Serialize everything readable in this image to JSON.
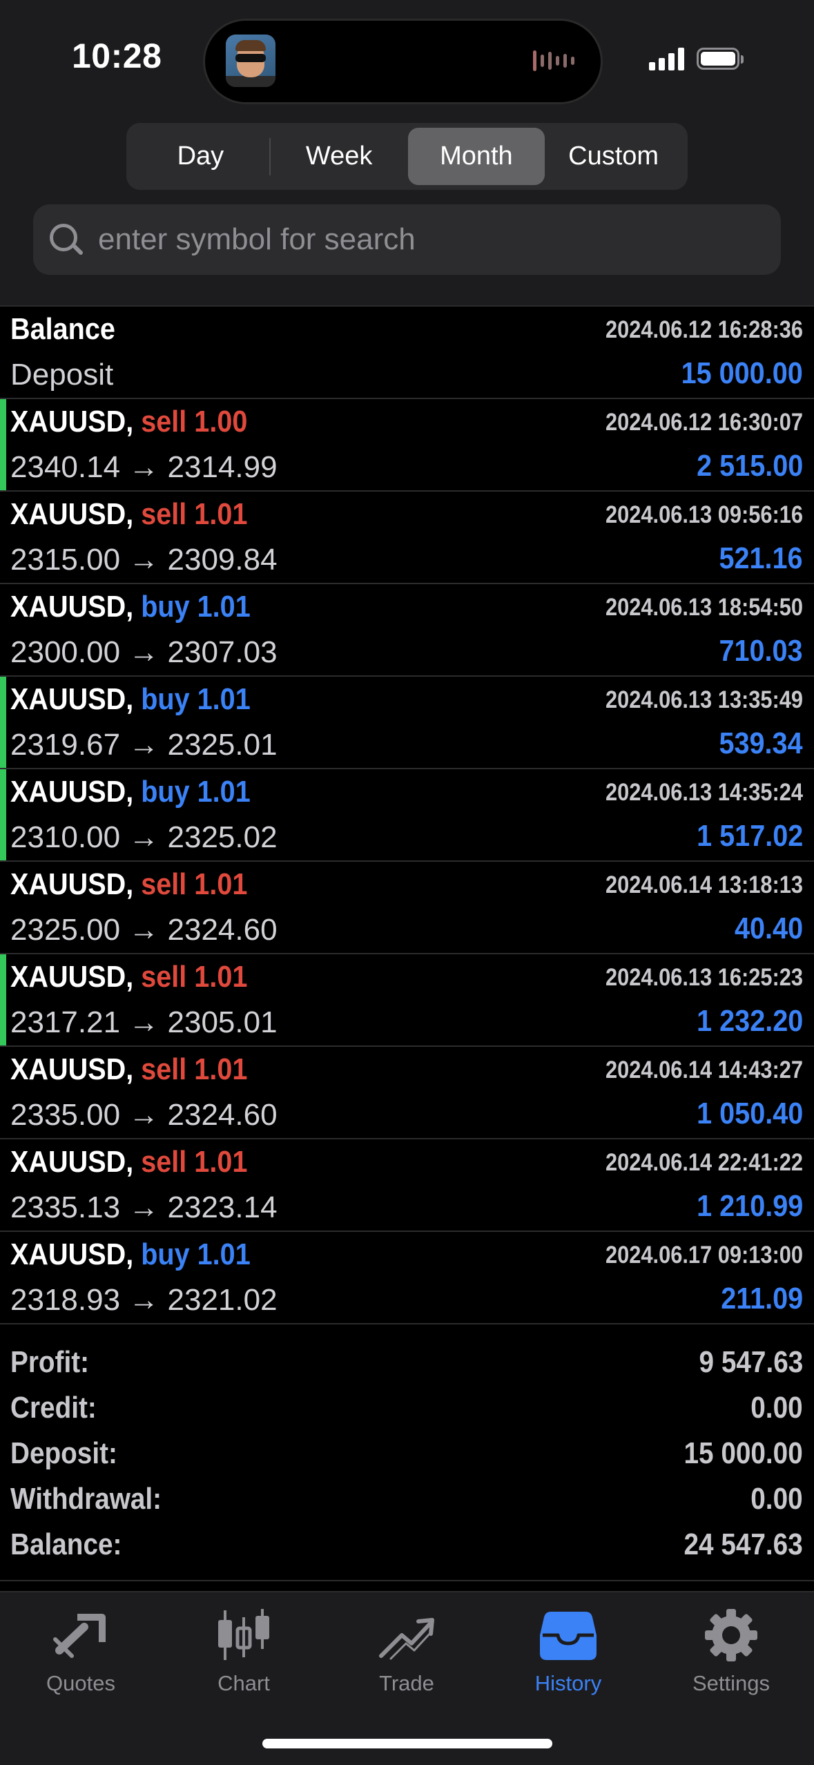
{
  "status_bar": {
    "time": "10:28"
  },
  "segmented": {
    "options": [
      "Day",
      "Week",
      "Month",
      "Custom"
    ],
    "selected": "Month"
  },
  "search": {
    "placeholder": "enter symbol for search"
  },
  "balance_row": {
    "title": "Balance",
    "timestamp": "2024.06.12 16:28:36",
    "subtitle": "Deposit",
    "amount": "15 000.00"
  },
  "trades": [
    {
      "symbol": "XAUUSD,",
      "side": "sell 1.00",
      "type": "sell",
      "timestamp": "2024.06.12 16:30:07",
      "prices": "2340.14 → 2314.99",
      "profit": "2 515.00",
      "marked": true
    },
    {
      "symbol": "XAUUSD,",
      "side": "sell 1.01",
      "type": "sell",
      "timestamp": "2024.06.13 09:56:16",
      "prices": "2315.00 → 2309.84",
      "profit": "521.16",
      "marked": false
    },
    {
      "symbol": "XAUUSD,",
      "side": "buy 1.01",
      "type": "buy",
      "timestamp": "2024.06.13 18:54:50",
      "prices": "2300.00 → 2307.03",
      "profit": "710.03",
      "marked": false
    },
    {
      "symbol": "XAUUSD,",
      "side": "buy 1.01",
      "type": "buy",
      "timestamp": "2024.06.13 13:35:49",
      "prices": "2319.67 → 2325.01",
      "profit": "539.34",
      "marked": true
    },
    {
      "symbol": "XAUUSD,",
      "side": "buy 1.01",
      "type": "buy",
      "timestamp": "2024.06.13 14:35:24",
      "prices": "2310.00 → 2325.02",
      "profit": "1 517.02",
      "marked": true
    },
    {
      "symbol": "XAUUSD,",
      "side": "sell 1.01",
      "type": "sell",
      "timestamp": "2024.06.14 13:18:13",
      "prices": "2325.00 → 2324.60",
      "profit": "40.40",
      "marked": false
    },
    {
      "symbol": "XAUUSD,",
      "side": "sell 1.01",
      "type": "sell",
      "timestamp": "2024.06.13 16:25:23",
      "prices": "2317.21 → 2305.01",
      "profit": "1 232.20",
      "marked": true
    },
    {
      "symbol": "XAUUSD,",
      "side": "sell 1.01",
      "type": "sell",
      "timestamp": "2024.06.14 14:43:27",
      "prices": "2335.00 → 2324.60",
      "profit": "1 050.40",
      "marked": false
    },
    {
      "symbol": "XAUUSD,",
      "side": "sell 1.01",
      "type": "sell",
      "timestamp": "2024.06.14 22:41:22",
      "prices": "2335.13 → 2323.14",
      "profit": "1 210.99",
      "marked": false
    },
    {
      "symbol": "XAUUSD,",
      "side": "buy 1.01",
      "type": "buy",
      "timestamp": "2024.06.17 09:13:00",
      "prices": "2318.93 → 2321.02",
      "profit": "211.09",
      "marked": false
    }
  ],
  "summary": [
    {
      "label": "Profit:",
      "value": "9 547.63"
    },
    {
      "label": "Credit:",
      "value": "0.00"
    },
    {
      "label": "Deposit:",
      "value": "15 000.00"
    },
    {
      "label": "Withdrawal:",
      "value": "0.00"
    },
    {
      "label": "Balance:",
      "value": "24 547.63"
    }
  ],
  "tabbar": {
    "items": [
      {
        "label": "Quotes",
        "icon": "quotes-icon"
      },
      {
        "label": "Chart",
        "icon": "candlestick-chart-icon"
      },
      {
        "label": "Trade",
        "icon": "trade-trend-icon"
      },
      {
        "label": "History",
        "icon": "history-tray-icon"
      },
      {
        "label": "Settings",
        "icon": "gear-icon"
      }
    ],
    "active": "History"
  },
  "colors": {
    "sell": "#e0493c",
    "buy": "#3b82f6",
    "profit": "#3b82f6",
    "marker": "#34c759",
    "active_tab": "#3b82f6"
  }
}
